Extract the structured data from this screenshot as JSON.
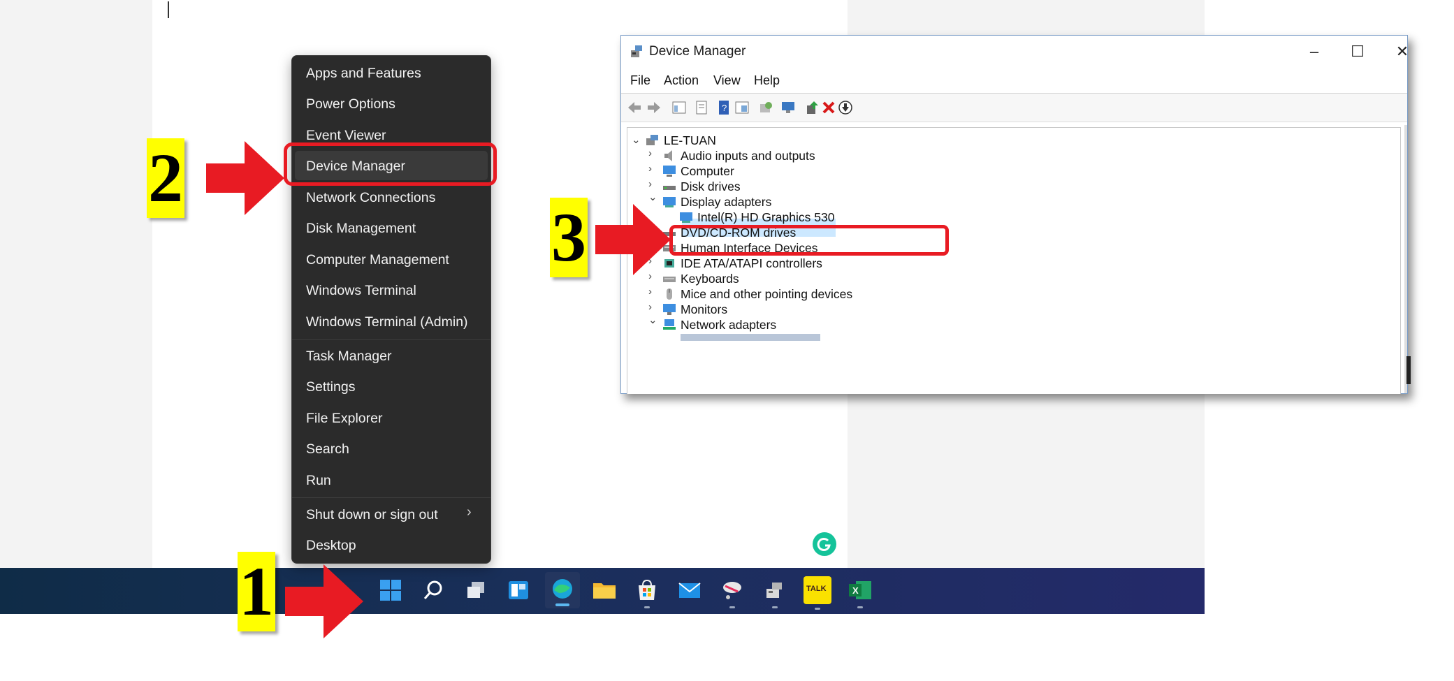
{
  "context_menu": {
    "items": [
      {
        "label": "Apps and Features"
      },
      {
        "label": "Power Options"
      },
      {
        "label": "Event Viewer"
      },
      {
        "label": "Device Manager"
      },
      {
        "label": "Network Connections"
      },
      {
        "label": "Disk Management"
      },
      {
        "label": "Computer Management"
      },
      {
        "label": "Windows Terminal"
      },
      {
        "label": "Windows Terminal (Admin)"
      },
      {
        "label": "Task Manager"
      },
      {
        "label": "Settings"
      },
      {
        "label": "File Explorer"
      },
      {
        "label": "Search"
      },
      {
        "label": "Run"
      },
      {
        "label": "Shut down or sign out"
      },
      {
        "label": "Desktop"
      }
    ],
    "highlighted": "Device Manager"
  },
  "step_labels": {
    "one": "1",
    "two": "2",
    "three": "3"
  },
  "device_manager": {
    "title": "Device Manager",
    "menu": [
      "File",
      "Action",
      "View",
      "Help"
    ],
    "window_controls": {
      "minimize": "–",
      "maximize": "☐",
      "close": "✕"
    },
    "tree": {
      "root": "LE-TUAN",
      "nodes": [
        {
          "label": "Audio inputs and outputs",
          "expanded": false
        },
        {
          "label": "Computer",
          "expanded": false
        },
        {
          "label": "Disk drives",
          "expanded": false
        },
        {
          "label": "Display adapters",
          "expanded": true
        },
        {
          "label": "Intel(R) HD Graphics 530",
          "child": true,
          "selected": true
        },
        {
          "label": "DVD/CD-ROM drives",
          "expanded": false
        },
        {
          "label": "Human Interface Devices",
          "expanded": false
        },
        {
          "label": "IDE ATA/ATAPI controllers",
          "expanded": false
        },
        {
          "label": "Keyboards",
          "expanded": false
        },
        {
          "label": "Mice and other pointing devices",
          "expanded": false
        },
        {
          "label": "Monitors",
          "expanded": false
        },
        {
          "label": "Network adapters",
          "expanded": true
        }
      ]
    }
  },
  "taskbar": {
    "icons": [
      "windows-start-icon",
      "search-icon",
      "task-view-icon",
      "widgets-icon",
      "edge-icon",
      "file-explorer-icon",
      "store-icon",
      "mail-icon",
      "snipping-icon",
      "network-app-icon",
      "kakaotalk-icon",
      "excel-icon"
    ],
    "kakaotalk_text": "TALK",
    "excel_text": "X"
  },
  "colors": {
    "accent_red": "#e81b23",
    "label_yellow": "#ffff00",
    "menu_bg": "#2b2b2b",
    "grammarly_green": "#15c39a"
  }
}
